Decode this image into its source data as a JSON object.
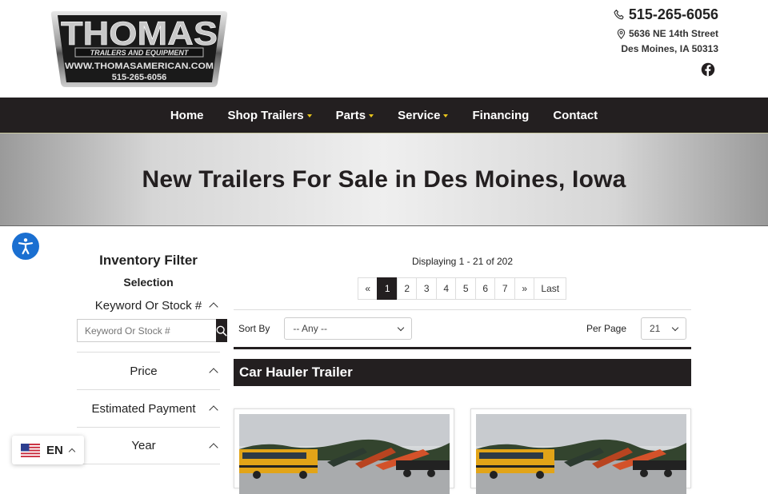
{
  "header": {
    "logo": {
      "name": "THOMAS",
      "tagline": "TRAILERS AND EQUIPMENT",
      "website": "WWW.THOMASAMERICAN.COM",
      "phone": "515-265-6056"
    },
    "phone": "515-265-6056",
    "address_line1": "5636 NE 14th Street",
    "address_line2": "Des Moines, IA 50313",
    "social_icon": "facebook-icon"
  },
  "nav": {
    "items": [
      {
        "label": "Home",
        "dropdown": false
      },
      {
        "label": "Shop Trailers",
        "dropdown": true
      },
      {
        "label": "Parts",
        "dropdown": true
      },
      {
        "label": "Service",
        "dropdown": true
      },
      {
        "label": "Financing",
        "dropdown": false
      },
      {
        "label": "Contact",
        "dropdown": false
      }
    ],
    "background": "#231f20",
    "caret_color": "#e8c41c"
  },
  "hero": {
    "title": "New Trailers For Sale in Des Moines, Iowa"
  },
  "sidebar": {
    "title": "Inventory Filter",
    "subtitle": "Selection",
    "keyword_label": "Keyword Or Stock #",
    "keyword_placeholder": "Keyword Or Stock #",
    "sections": [
      "Price",
      "Estimated Payment",
      "Year"
    ]
  },
  "main": {
    "displaying": "Displaying 1 - 21 of 202",
    "pagination": {
      "prev": "«",
      "pages": [
        "1",
        "2",
        "3",
        "4",
        "5",
        "6",
        "7"
      ],
      "next": "»",
      "last": "Last",
      "current": "1"
    },
    "sort_label": "Sort By",
    "sort_value": "-- Any --",
    "per_page_label": "Per Page",
    "per_page_value": "21",
    "category_title": "Car Hauler Trailer"
  },
  "language": {
    "code": "EN",
    "flag": "us-flag-icon"
  },
  "colors": {
    "accessibility_blue": "#1a6fd1",
    "dark": "#231f20"
  }
}
